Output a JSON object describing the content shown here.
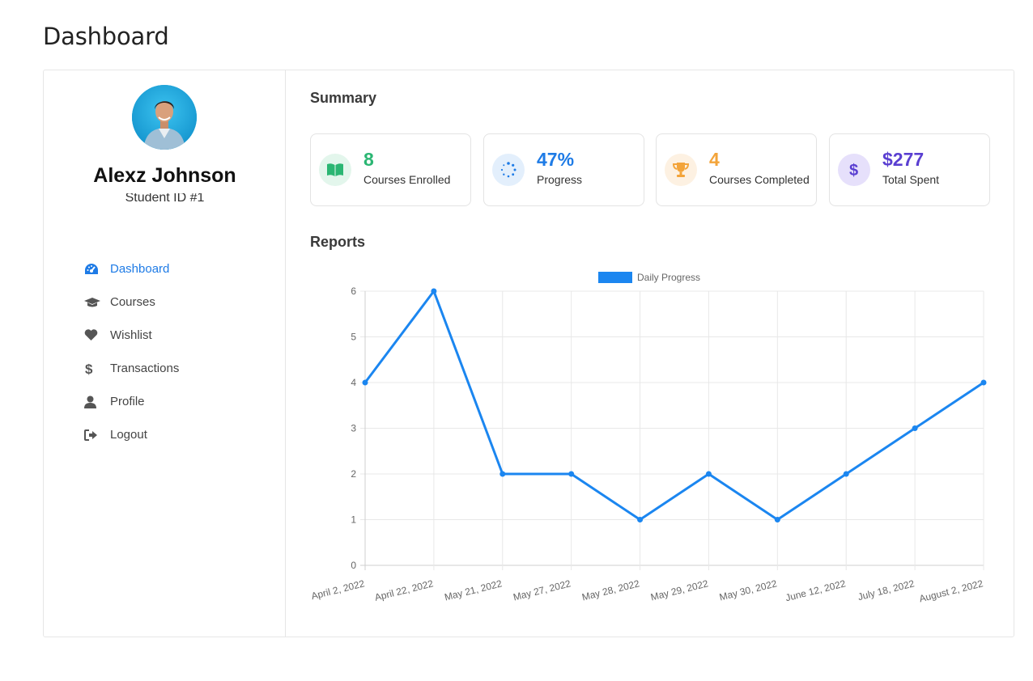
{
  "page": {
    "title": "Dashboard"
  },
  "profile": {
    "name": "Alexz Johnson",
    "student_id": "Student ID #1"
  },
  "nav": [
    {
      "label": "Dashboard",
      "icon": "dashboard-gauge-icon",
      "active": true
    },
    {
      "label": "Courses",
      "icon": "graduation-cap-icon",
      "active": false
    },
    {
      "label": "Wishlist",
      "icon": "heart-icon",
      "active": false
    },
    {
      "label": "Transactions",
      "icon": "dollar-icon",
      "active": false
    },
    {
      "label": "Profile",
      "icon": "user-icon",
      "active": false
    },
    {
      "label": "Logout",
      "icon": "logout-icon",
      "active": false
    }
  ],
  "summary": {
    "title": "Summary",
    "stats": [
      {
        "value": "8",
        "label": "Courses Enrolled",
        "icon": "book-open-icon",
        "color": "#2bb673",
        "bg": "#e3f6ec"
      },
      {
        "value": "47%",
        "label": "Progress",
        "icon": "spinner-icon",
        "color": "#1e7be6",
        "bg": "#e3effc"
      },
      {
        "value": "4",
        "label": "Courses Completed",
        "icon": "trophy-icon",
        "color": "#f3a43a",
        "bg": "#fdf1e2"
      },
      {
        "value": "$277",
        "label": "Total Spent",
        "icon": "dollar-icon",
        "color": "#5a3fd1",
        "bg": "#e6e0fb"
      }
    ]
  },
  "reports": {
    "title": "Reports"
  },
  "chart_data": {
    "type": "line",
    "categories": [
      "April 2, 2022",
      "April 22, 2022",
      "May 21, 2022",
      "May 27, 2022",
      "May 28, 2022",
      "May 29, 2022",
      "May 30, 2022",
      "June 12, 2022",
      "July 18, 2022",
      "August 2, 2022"
    ],
    "series": [
      {
        "name": "Daily Progress",
        "values": [
          4,
          6,
          2,
          2,
          1,
          2,
          1,
          2,
          3,
          4
        ],
        "color": "#1b86f0"
      }
    ],
    "ylim": [
      0,
      6
    ],
    "yticks": [
      "0",
      "1",
      "2",
      "3",
      "4",
      "5",
      "6"
    ],
    "grid": true,
    "legend": "top-center"
  }
}
